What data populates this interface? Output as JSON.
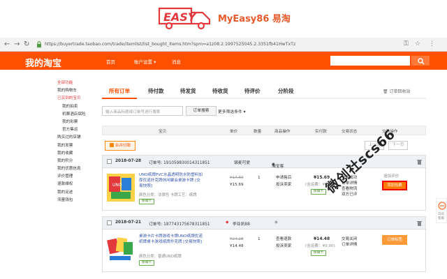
{
  "banner": {
    "brand": "MyEasy86",
    "brand_cn": "易淘",
    "logo_letters": "EASY"
  },
  "browser": {
    "url": "https://buyertrade.taobao.com/trade/itemlist/list_bought_items.htm?spm=a1z08.2.1997525045.2.3351fb41HwTxTz"
  },
  "header": {
    "logo": "我的淘宝",
    "nav": [
      "首页",
      "账户设置 ▾",
      "消息"
    ]
  },
  "sidebar": {
    "items": [
      {
        "label": "全部功能",
        "style": "red"
      },
      {
        "label": "我的购物车",
        "style": ""
      },
      {
        "label": "已买到的宝贝",
        "style": "red"
      },
      {
        "label": "我的拍卖",
        "style": "sub"
      },
      {
        "label": "机票酒店保险",
        "style": "sub"
      },
      {
        "label": "我的彩票",
        "style": "sub"
      },
      {
        "label": "官方集运",
        "style": "sub"
      },
      {
        "label": "购买过的店铺",
        "style": ""
      },
      {
        "label": "我的发票",
        "style": ""
      },
      {
        "label": "我的收藏",
        "style": ""
      },
      {
        "label": "我的积分",
        "style": ""
      },
      {
        "label": "我的优惠信息",
        "style": ""
      },
      {
        "label": "评价管理",
        "style": ""
      },
      {
        "label": "退款维权",
        "style": ""
      },
      {
        "label": "我的足迹",
        "style": ""
      },
      {
        "label": "流量钱包",
        "style": ""
      }
    ]
  },
  "tabs": [
    "所有订单",
    "待付款",
    "待发货",
    "待收货",
    "待评价",
    "分阶段"
  ],
  "trash_link": "订单回收站",
  "search": {
    "placeholder": "输入商品标题或订单号进行搜索",
    "button": "订单搜索",
    "more": "更多筛选条件 ▾"
  },
  "columns": [
    "宝贝",
    "单价",
    "数量",
    "商品操作",
    "实付款",
    "交易状态",
    "交易操作"
  ],
  "batch": {
    "merge": "合并付款",
    "prev": "上一页",
    "next": "下一页"
  },
  "orders": [
    {
      "date": "2018-07-28",
      "order_no_label": "订单号: 191059830014311851",
      "seller": "锦麦可爱",
      "seller_tag": "淘宝客",
      "title": "UNO纸牌PVC水晶透明防水防塑料加厚优诺扑克牌休闲聚会桌游卡牌 [交易快照]",
      "attr": "颜色分类：法律色  卡牌工艺：纸牌",
      "badge": "保障卡",
      "orig_price": "¥17.60",
      "price": "¥15.69",
      "qty": "1",
      "ops": [
        "申请售后",
        "投诉卖家"
      ],
      "paid": "¥15.69",
      "shipping": "(含运费：¥0.00)",
      "paid_badge": "保障卡",
      "status": [
        "交易成功",
        "订单详情",
        "查看物流",
        "双方已评"
      ],
      "action_top": "追加评价",
      "action_btn": "添加包裹"
    },
    {
      "date": "2018-07-21",
      "order_no_label": "订单号: 187743175678311851",
      "seller": "李亚凯88",
      "seller_tag": "",
      "title": "桌游卡片卡牌游戏卡牌UNO纸牌优诺纸牌桌卡游戏纸牌扑克牌 [交易快照]",
      "attr": "颜色分类：普通UNO纸牌",
      "badge": "保障卡",
      "orig_price": "¥24.28",
      "price": "¥14.48",
      "qty": "1",
      "ops": [
        "查看退款",
        "投诉卖家"
      ],
      "paid": "¥14.48",
      "shipping": "(含运费：¥0.00)",
      "paid_badge": "保障卡",
      "status": [
        "交易关闭",
        "订单详情"
      ],
      "action_top": "",
      "action_btn": "订单标签"
    }
  ],
  "watermark": "微创社scs66",
  "side_float": "向问\n客服"
}
